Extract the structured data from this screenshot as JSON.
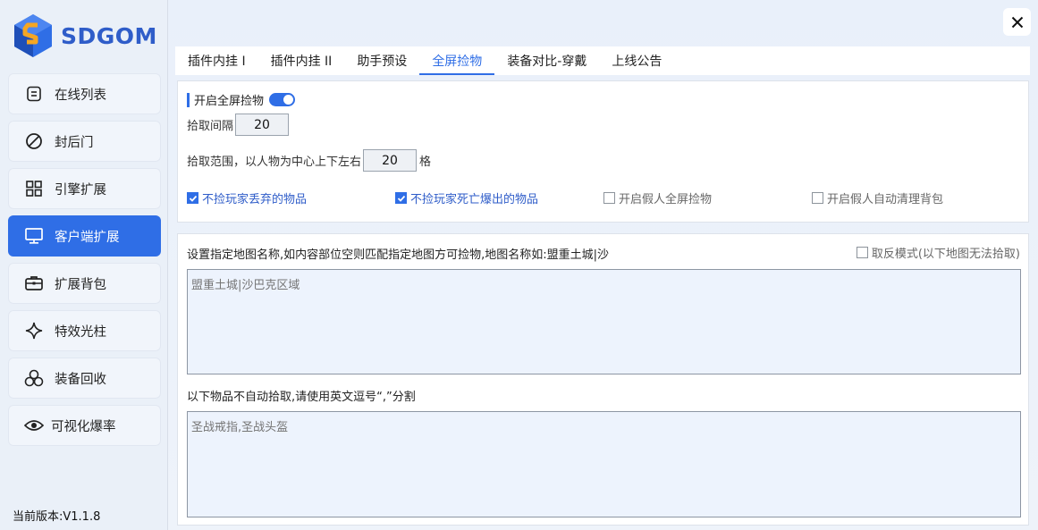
{
  "brand": {
    "name": "SDGOM"
  },
  "sidebar": {
    "items": [
      {
        "label": "在线列表",
        "icon": "list-icon"
      },
      {
        "label": "封后门",
        "icon": "block-icon"
      },
      {
        "label": "引擎扩展",
        "icon": "grid-icon"
      },
      {
        "label": "客户端扩展",
        "icon": "monitor-icon",
        "active": true
      },
      {
        "label": "扩展背包",
        "icon": "bag-icon"
      },
      {
        "label": "特效光柱",
        "icon": "sparkle-icon"
      },
      {
        "label": "装备回收",
        "icon": "recycle-icon"
      },
      {
        "label": "可视化爆率",
        "icon": "eye-icon"
      }
    ],
    "version": "当前版本:V1.1.8"
  },
  "tabs": [
    {
      "label": "插件内挂 I"
    },
    {
      "label": "插件内挂 II"
    },
    {
      "label": "助手预设"
    },
    {
      "label": "全屏捡物",
      "active": true
    },
    {
      "label": "装备对比-穿戴"
    },
    {
      "label": "上线公告"
    }
  ],
  "pickup": {
    "title": "开启全屏捡物",
    "enabled": true,
    "interval_label": "拾取间隔",
    "interval_value": "20",
    "range_label": "拾取范围，以人物为中心上下左右",
    "range_value": "20",
    "range_unit": "格",
    "options": [
      {
        "label": "不捡玩家丢弃的物品",
        "checked": true
      },
      {
        "label": "不捡玩家死亡爆出的物品",
        "checked": true
      },
      {
        "label": "开启假人全屏捡物",
        "checked": false
      },
      {
        "label": "开启假人自动清理背包",
        "checked": false
      }
    ]
  },
  "maps": {
    "label": "设置指定地图名称,如内容部位空则匹配指定地图方可捡物,地图名称如:盟重土城|沙",
    "invert_label": "取反模式(以下地图无法拾取)",
    "invert_checked": false,
    "placeholder": "盟重土城|沙巴克区域"
  },
  "exclude": {
    "label": "以下物品不自动拾取,请使用英文逗号“,”分割",
    "placeholder": "圣战戒指,圣战头盔"
  },
  "colors": {
    "accent": "#2f6ee6",
    "brand": "#2f5dc9"
  }
}
